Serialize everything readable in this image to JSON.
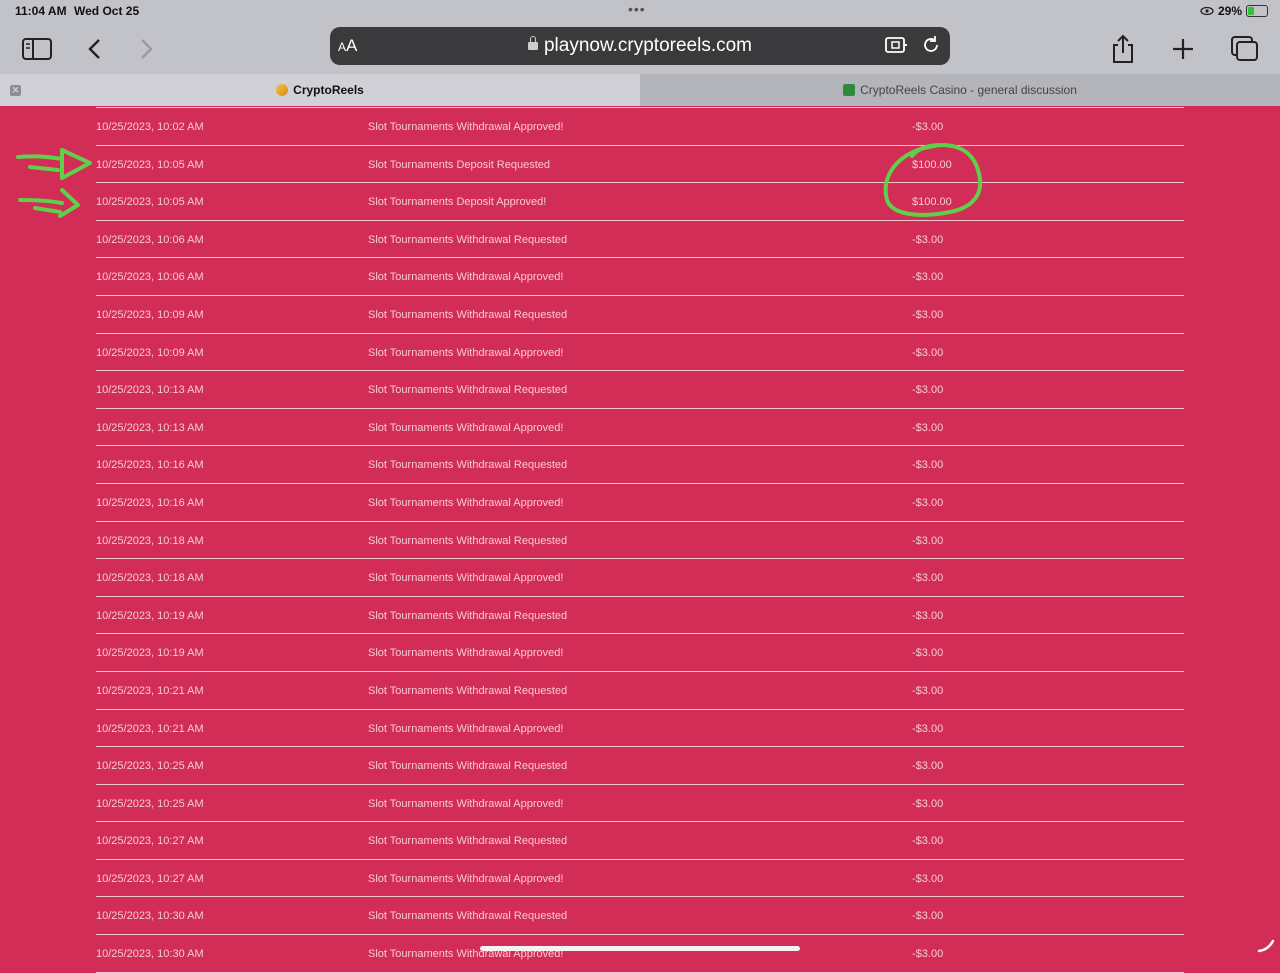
{
  "status": {
    "time": "11:04 AM",
    "date": "Wed Oct 25",
    "battery": "29%"
  },
  "browser": {
    "aa_small": "A",
    "aa_large": "A",
    "url": "playnow.cryptoreels.com",
    "tabs": [
      {
        "label": "CryptoReels",
        "active": true
      },
      {
        "label": "CryptoReels Casino - general discussion",
        "active": false
      }
    ]
  },
  "transactions": [
    {
      "datetime": "10/25/2023, 10:02 AM",
      "description": "Slot Tournaments Withdrawal Approved!",
      "amount": "-$3.00"
    },
    {
      "datetime": "10/25/2023, 10:05 AM",
      "description": "Slot Tournaments Deposit Requested",
      "amount": "$100.00"
    },
    {
      "datetime": "10/25/2023, 10:05 AM",
      "description": "Slot Tournaments Deposit Approved!",
      "amount": "$100.00"
    },
    {
      "datetime": "10/25/2023, 10:06 AM",
      "description": "Slot Tournaments Withdrawal Requested",
      "amount": "-$3.00"
    },
    {
      "datetime": "10/25/2023, 10:06 AM",
      "description": "Slot Tournaments Withdrawal Approved!",
      "amount": "-$3.00"
    },
    {
      "datetime": "10/25/2023, 10:09 AM",
      "description": "Slot Tournaments Withdrawal Requested",
      "amount": "-$3.00"
    },
    {
      "datetime": "10/25/2023, 10:09 AM",
      "description": "Slot Tournaments Withdrawal Approved!",
      "amount": "-$3.00"
    },
    {
      "datetime": "10/25/2023, 10:13 AM",
      "description": "Slot Tournaments Withdrawal Requested",
      "amount": "-$3.00"
    },
    {
      "datetime": "10/25/2023, 10:13 AM",
      "description": "Slot Tournaments Withdrawal Approved!",
      "amount": "-$3.00"
    },
    {
      "datetime": "10/25/2023, 10:16 AM",
      "description": "Slot Tournaments Withdrawal Requested",
      "amount": "-$3.00"
    },
    {
      "datetime": "10/25/2023, 10:16 AM",
      "description": "Slot Tournaments Withdrawal Approved!",
      "amount": "-$3.00"
    },
    {
      "datetime": "10/25/2023, 10:18 AM",
      "description": "Slot Tournaments Withdrawal Requested",
      "amount": "-$3.00"
    },
    {
      "datetime": "10/25/2023, 10:18 AM",
      "description": "Slot Tournaments Withdrawal Approved!",
      "amount": "-$3.00"
    },
    {
      "datetime": "10/25/2023, 10:19 AM",
      "description": "Slot Tournaments Withdrawal Requested",
      "amount": "-$3.00"
    },
    {
      "datetime": "10/25/2023, 10:19 AM",
      "description": "Slot Tournaments Withdrawal Approved!",
      "amount": "-$3.00"
    },
    {
      "datetime": "10/25/2023, 10:21 AM",
      "description": "Slot Tournaments Withdrawal Requested",
      "amount": "-$3.00"
    },
    {
      "datetime": "10/25/2023, 10:21 AM",
      "description": "Slot Tournaments Withdrawal Approved!",
      "amount": "-$3.00"
    },
    {
      "datetime": "10/25/2023, 10:25 AM",
      "description": "Slot Tournaments Withdrawal Requested",
      "amount": "-$3.00"
    },
    {
      "datetime": "10/25/2023, 10:25 AM",
      "description": "Slot Tournaments Withdrawal Approved!",
      "amount": "-$3.00"
    },
    {
      "datetime": "10/25/2023, 10:27 AM",
      "description": "Slot Tournaments Withdrawal Requested",
      "amount": "-$3.00"
    },
    {
      "datetime": "10/25/2023, 10:27 AM",
      "description": "Slot Tournaments Withdrawal Approved!",
      "amount": "-$3.00"
    },
    {
      "datetime": "10/25/2023, 10:30 AM",
      "description": "Slot Tournaments Withdrawal Requested",
      "amount": "-$3.00"
    },
    {
      "datetime": "10/25/2023, 10:30 AM",
      "description": "Slot Tournaments Withdrawal Approved!",
      "amount": "-$3.00"
    }
  ],
  "colors": {
    "page_background": "#d22d56",
    "annotation": "#5fd04a"
  },
  "icons": [
    "sidebar-icon",
    "back-icon",
    "forward-icon",
    "lock-icon",
    "extension-icon",
    "reload-icon",
    "share-icon",
    "new-tab-icon",
    "tabs-overview-icon",
    "tab-close-icon"
  ]
}
